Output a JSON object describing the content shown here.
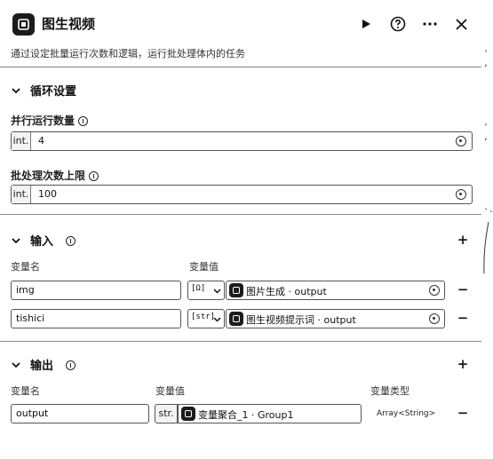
{
  "header": {
    "title": "图生视频",
    "description": "通过设定批量运行次数和逻辑，运行批处理体内的任务",
    "icons": [
      "run-icon",
      "help-icon",
      "more-icon",
      "close-icon"
    ]
  },
  "loop_settings": {
    "section_title": "循环设置",
    "parallel_label": "并行运行数量",
    "parallel_type": "int.",
    "parallel_value": "4",
    "limit_label": "批处理次数上限",
    "limit_type": "int.",
    "limit_value": "100"
  },
  "inputs": {
    "section_title": "输入",
    "col_name": "变量名",
    "col_value": "变量值",
    "rows": [
      {
        "name": "img",
        "type_tag": "[Ω]",
        "ref": "图片生成 · output"
      },
      {
        "name": "tishici",
        "type_tag": "[str]",
        "ref": "图生视频提示词 · output"
      }
    ]
  },
  "outputs": {
    "section_title": "输出",
    "col_name": "变量名",
    "col_value": "变量值",
    "col_type": "变量类型",
    "rows": [
      {
        "name": "output",
        "type_tag": "str.",
        "ref": "变量聚合_1 · Group1",
        "var_type": "Array<String>"
      }
    ]
  },
  "side_marks": [
    "' ,",
    "' ,",
    "'-"
  ]
}
